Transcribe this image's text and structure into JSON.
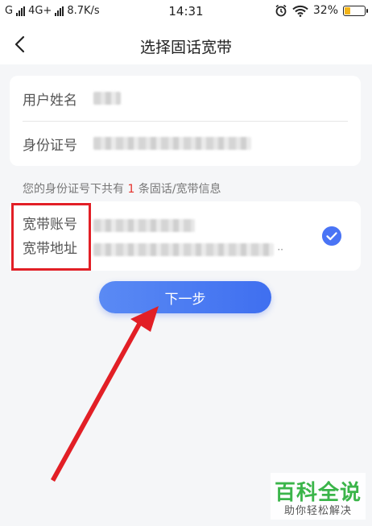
{
  "status_bar": {
    "carrier_left": "G",
    "network": "4G+",
    "speed": "8.7K/s",
    "time": "14:31",
    "battery": "32%",
    "battery_level": 0.32,
    "battery_color": "#f3b419"
  },
  "header": {
    "title": "选择固话宽带",
    "back_icon": "chevron-left-icon"
  },
  "identity_card": {
    "name_label": "用户姓名",
    "id_label": "身份证号"
  },
  "info": {
    "prefix": "您的身份证号下共有",
    "count": "1",
    "suffix": "条固话/宽带信息"
  },
  "broadband_card": {
    "account_label": "宽带账号",
    "address_label": "宽带地址",
    "address_ellipsis": "··",
    "check_icon": "check-circle-icon",
    "accent": "#4a74f5"
  },
  "next_button": {
    "label": "下一步"
  },
  "watermark": {
    "title": "百科全说",
    "subtitle": "助你轻松解决"
  },
  "colors": {
    "highlight": "#e21f26",
    "arrow": "#e21f26",
    "button": "#4a74f5",
    "watermark": "#3bb54a"
  }
}
